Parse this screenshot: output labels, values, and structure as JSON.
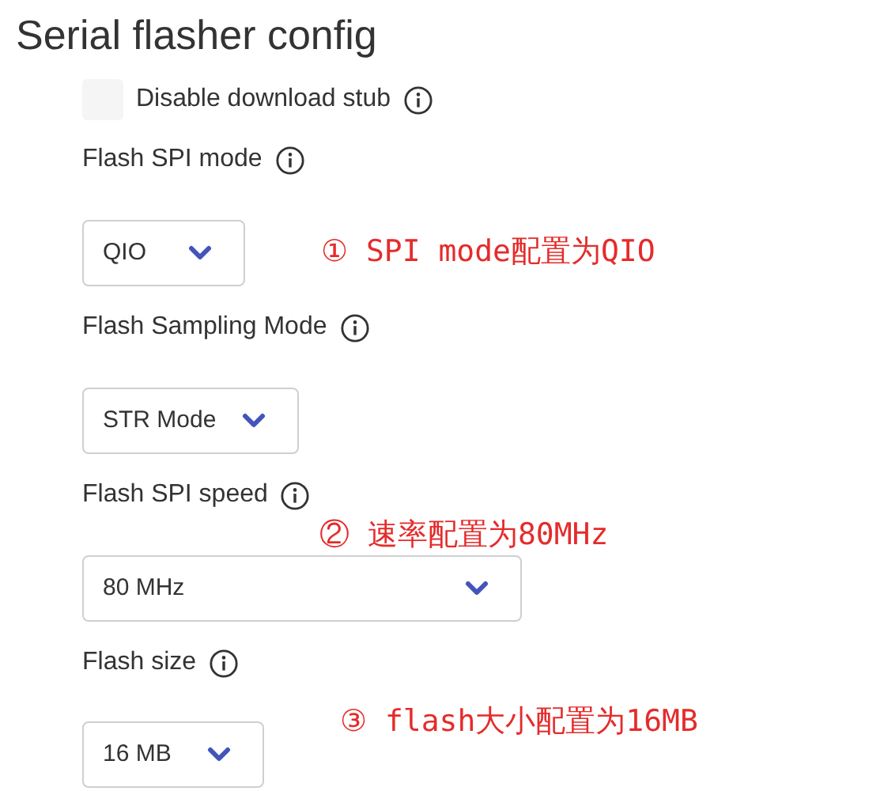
{
  "title": "Serial flasher config",
  "checkbox": {
    "label": "Disable download stub",
    "checked": false
  },
  "settings": [
    {
      "label": "Flash SPI mode",
      "value": "QIO",
      "annotation": {
        "text": "① SPI mode配置为QIO",
        "kind": "beside"
      }
    },
    {
      "label": "Flash Sampling Mode",
      "value": "STR Mode"
    },
    {
      "label": "Flash SPI speed",
      "value": "80 MHz",
      "annotation": {
        "text": "② 速率配置为80MHz",
        "kind": "above"
      }
    },
    {
      "label": "Flash size",
      "value": "16 MB",
      "annotation": {
        "text": "③ flash大小配置为16MB",
        "kind": "beside"
      }
    }
  ]
}
